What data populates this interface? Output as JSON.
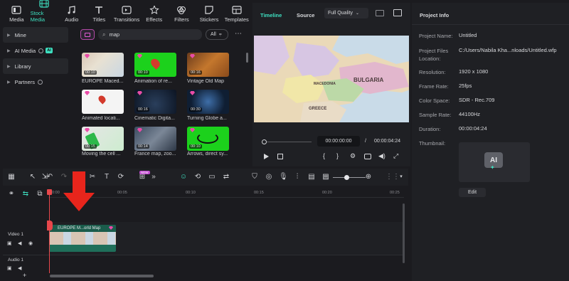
{
  "topnav": [
    {
      "label": "Media",
      "icon": "media-icon",
      "active": false
    },
    {
      "label": "Stock Media",
      "icon": "stock-media-icon",
      "active": true
    },
    {
      "label": "Audio",
      "icon": "audio-icon",
      "active": false
    },
    {
      "label": "Titles",
      "icon": "titles-icon",
      "active": false
    },
    {
      "label": "Transitions",
      "icon": "transitions-icon",
      "active": false
    },
    {
      "label": "Effects",
      "icon": "effects-icon",
      "active": false
    },
    {
      "label": "Filters",
      "icon": "filters-icon",
      "active": false
    },
    {
      "label": "Stickers",
      "icon": "stickers-icon",
      "active": false
    },
    {
      "label": "Templates",
      "icon": "templates-icon",
      "active": false
    }
  ],
  "sidebar": {
    "items": [
      {
        "label": "Mine"
      },
      {
        "label": "AI Media",
        "badge": "AI"
      },
      {
        "label": "Library"
      },
      {
        "label": "Partners"
      }
    ]
  },
  "search": {
    "value": "map",
    "filter": "All"
  },
  "thumbs": [
    {
      "label": "EUROPE Maced...",
      "dur": "00:10"
    },
    {
      "label": "Animation of re...",
      "dur": "00:10"
    },
    {
      "label": "Vintage Old Map",
      "dur": "00:16"
    },
    {
      "label": "Animated locati...",
      "dur": ""
    },
    {
      "label": "Cinematic Digita...",
      "dur": "00:16"
    },
    {
      "label": "Turning Globe a...",
      "dur": "00:30"
    },
    {
      "label": "Moving the cell ...",
      "dur": "00:15"
    },
    {
      "label": "France map, zoo...",
      "dur": "00:14"
    },
    {
      "label": "Arrows, direct sy...",
      "dur": "00:10"
    }
  ],
  "preview": {
    "tab_timeline": "Timeline",
    "tab_source": "Source",
    "quality": "Full Quality",
    "time_current": "00:00:00:00",
    "time_sep": "/",
    "time_total": "00:00:04:24",
    "map_labels": [
      "BULGARIA",
      "MACEDONIA",
      "GREECE"
    ]
  },
  "project_info": {
    "title": "Project Info",
    "rows": [
      {
        "label": "Project Name:",
        "value": "Untitled"
      },
      {
        "label": "Project Files Location:",
        "value": "C:/Users/Nabila Kha...nloads/Untitled.wfp"
      },
      {
        "label": "Resolution:",
        "value": "1920 x 1080"
      },
      {
        "label": "Frame Rate:",
        "value": "25fps"
      },
      {
        "label": "Color Space:",
        "value": "SDR - Rec.709"
      },
      {
        "label": "Sample Rate:",
        "value": "44100Hz"
      },
      {
        "label": "Duration:",
        "value": "00:00:04:24"
      },
      {
        "label": "Thumbnail:",
        "value": ""
      }
    ],
    "thumb_text": "AI",
    "edit_label": "Edit"
  },
  "timeline": {
    "badge": "NEW",
    "ruler": [
      "00:00",
      "00:05",
      "00:10",
      "00:15",
      "00:20",
      "00:25"
    ],
    "clip_label": "EUROPE M...orld Map",
    "tracks": [
      "Video 1",
      "Audio 1"
    ]
  },
  "colors": {
    "accent": "#3ee0c1",
    "arrow": "#e8251c",
    "playhead": "#e8474b"
  }
}
